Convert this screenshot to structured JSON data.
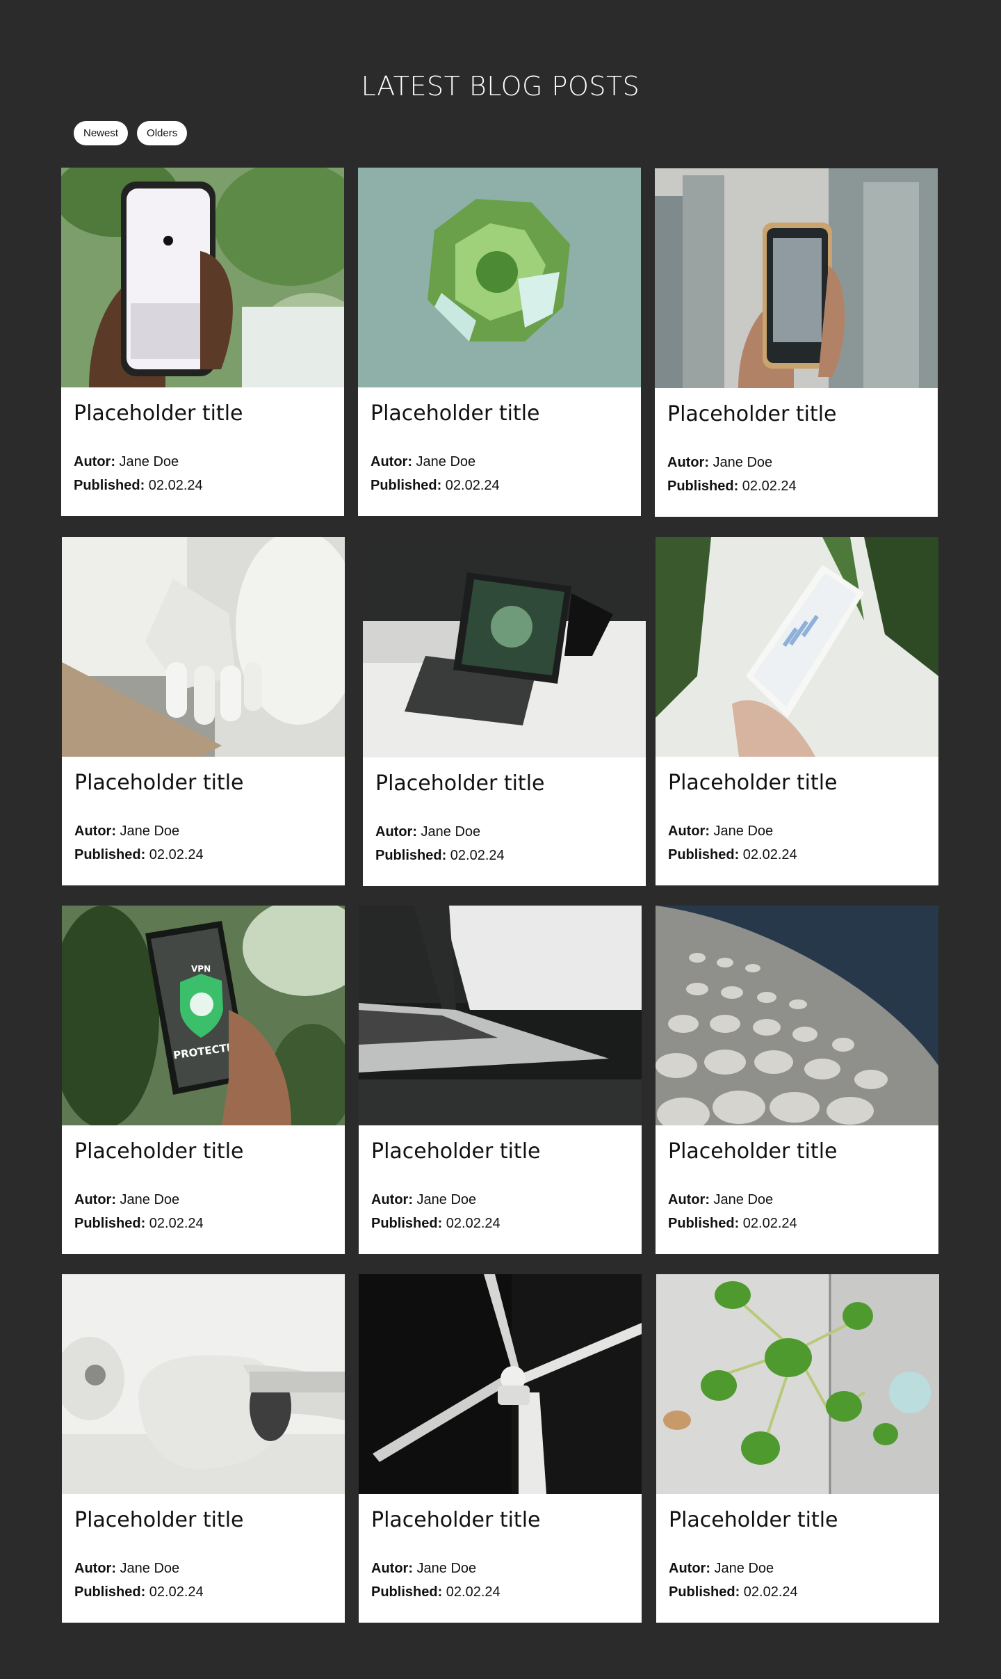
{
  "header": {
    "title": "LATEST BLOG POSTS"
  },
  "filters": [
    {
      "label": "Newest"
    },
    {
      "label": "Olders"
    }
  ],
  "meta_labels": {
    "author": "Autor:",
    "published": "Published:"
  },
  "posts": [
    {
      "title": "Placeholder title",
      "author": "Jane Doe",
      "published": "02.02.24",
      "image": "phone-chat-plant"
    },
    {
      "title": "Placeholder title",
      "author": "Jane Doe",
      "published": "02.02.24",
      "image": "green-crystal-sphere"
    },
    {
      "title": "Placeholder title",
      "author": "Jane Doe",
      "published": "02.02.24",
      "image": "phone-skyscrapers"
    },
    {
      "title": "Placeholder title",
      "author": "Jane Doe",
      "published": "02.02.24",
      "image": "robot-hand"
    },
    {
      "title": "Placeholder title",
      "author": "Jane Doe",
      "published": "02.02.24",
      "image": "tablet-keyboard"
    },
    {
      "title": "Placeholder title",
      "author": "Jane Doe",
      "published": "02.02.24",
      "image": "phone-analytics"
    },
    {
      "title": "Placeholder title",
      "author": "Jane Doe",
      "published": "02.02.24",
      "image": "phone-vpn"
    },
    {
      "title": "Placeholder title",
      "author": "Jane Doe",
      "published": "02.02.24",
      "image": "laptop"
    },
    {
      "title": "Placeholder title",
      "author": "Jane Doe",
      "published": "02.02.24",
      "image": "building-discs"
    },
    {
      "title": "Placeholder title",
      "author": "Jane Doe",
      "published": "02.02.24",
      "image": "vr-headset"
    },
    {
      "title": "Placeholder title",
      "author": "Jane Doe",
      "published": "02.02.24",
      "image": "wind-turbine"
    },
    {
      "title": "Placeholder title",
      "author": "Jane Doe",
      "published": "02.02.24",
      "image": "green-molecule"
    }
  ],
  "vpn_screen": {
    "label": "VPN",
    "status": "PROTECTED"
  },
  "colors": {
    "background": "#2b2b2b",
    "card": "#ffffff",
    "text": "#111111"
  }
}
